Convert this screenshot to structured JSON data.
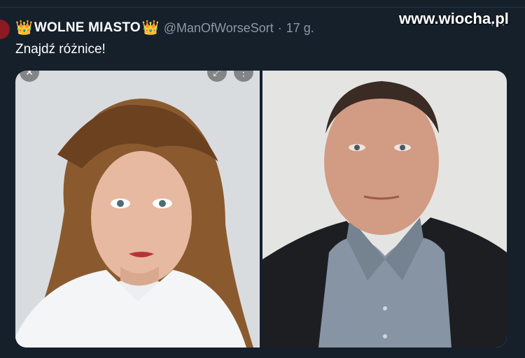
{
  "watermark": "www.wiocha.pl",
  "tweet": {
    "crown_left": "👑",
    "display_name": "WOLNE MIASTO",
    "crown_right": "👑",
    "handle": "@ManOfWorseSort",
    "separator": "·",
    "time": "17 g.",
    "text": "Znajdź różnice!",
    "more_icon": "···"
  },
  "media": {
    "left_photo": "woman-portrait",
    "right_photo": "man-portrait"
  },
  "colors": {
    "background": "#15202b",
    "secondary_text": "#8b98a5",
    "crown": "#f4b400"
  }
}
